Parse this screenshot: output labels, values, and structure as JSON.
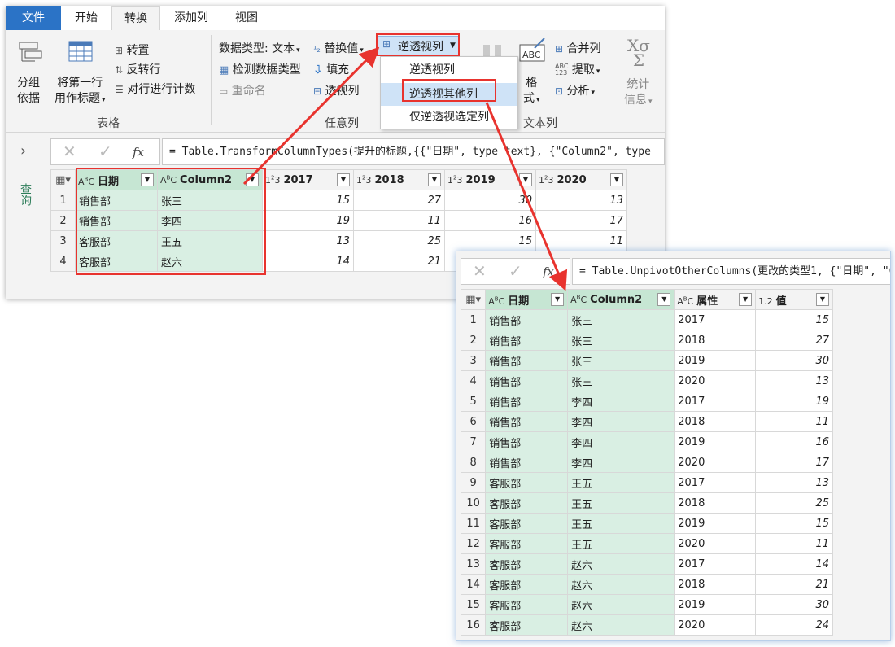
{
  "tabs": {
    "file": "文件",
    "home": "开始",
    "transform": "转换",
    "add_column": "添加列",
    "view": "视图"
  },
  "ribbon": {
    "table_group": {
      "group_by_line1": "分组",
      "group_by_line2": "依据",
      "use_first_row_line1": "将第一行",
      "use_first_row_line2": "用作标题",
      "transpose": "转置",
      "reverse_rows": "反转行",
      "count_rows": "对行进行计数",
      "label": "表格"
    },
    "any_column_group": {
      "data_type": "数据类型: 文本",
      "detect_type": "检测数据类型",
      "rename": "重命名",
      "replace_values": "替换值",
      "fill": "填充",
      "pivot": "透视列",
      "unpivot": "逆透视列",
      "label": "任意列"
    },
    "text_column_group": {
      "format_line1": "格",
      "format_line2": "式",
      "merge": "合并列",
      "extract": "提取",
      "parse": "分析",
      "label": "文本列"
    },
    "number_group": {
      "stats_line1": "统计",
      "stats_line2": "信息"
    }
  },
  "unpivot_menu": [
    "逆透视列",
    "逆透视其他列",
    "仅逆透视选定列"
  ],
  "queries_label": "查询",
  "fx_label": "fx",
  "formula1": "= Table.TransformColumnTypes(提升的标题,{{\"日期\", type text}, {\"Column2\", type",
  "table1": {
    "headers": [
      {
        "type": "ABC",
        "name": "日期"
      },
      {
        "type": "ABC",
        "name": "Column2"
      },
      {
        "type": "123",
        "name": "2017"
      },
      {
        "type": "123",
        "name": "2018"
      },
      {
        "type": "123",
        "name": "2019"
      },
      {
        "type": "123",
        "name": "2020"
      }
    ],
    "rows": [
      [
        "1",
        "销售部",
        "张三",
        "15",
        "27",
        "30",
        "13"
      ],
      [
        "2",
        "销售部",
        "李四",
        "19",
        "11",
        "16",
        "17"
      ],
      [
        "3",
        "客服部",
        "王五",
        "13",
        "25",
        "15",
        "11"
      ],
      [
        "4",
        "客服部",
        "赵六",
        "14",
        "21",
        "",
        ""
      ]
    ]
  },
  "formula2": "= Table.UnpivotOtherColumns(更改的类型1, {\"日期\", \"Column2\"}, \"属性\", \"值\")",
  "table2": {
    "headers": [
      {
        "type": "ABC",
        "name": "日期"
      },
      {
        "type": "ABC",
        "name": "Column2"
      },
      {
        "type": "ABC",
        "name": "属性"
      },
      {
        "type": "1.2",
        "name": "值"
      }
    ],
    "rows": [
      [
        "1",
        "销售部",
        "张三",
        "2017",
        "15"
      ],
      [
        "2",
        "销售部",
        "张三",
        "2018",
        "27"
      ],
      [
        "3",
        "销售部",
        "张三",
        "2019",
        "30"
      ],
      [
        "4",
        "销售部",
        "张三",
        "2020",
        "13"
      ],
      [
        "5",
        "销售部",
        "李四",
        "2017",
        "19"
      ],
      [
        "6",
        "销售部",
        "李四",
        "2018",
        "11"
      ],
      [
        "7",
        "销售部",
        "李四",
        "2019",
        "16"
      ],
      [
        "8",
        "销售部",
        "李四",
        "2020",
        "17"
      ],
      [
        "9",
        "客服部",
        "王五",
        "2017",
        "13"
      ],
      [
        "10",
        "客服部",
        "王五",
        "2018",
        "25"
      ],
      [
        "11",
        "客服部",
        "王五",
        "2019",
        "15"
      ],
      [
        "12",
        "客服部",
        "王五",
        "2020",
        "11"
      ],
      [
        "13",
        "客服部",
        "赵六",
        "2017",
        "14"
      ],
      [
        "14",
        "客服部",
        "赵六",
        "2018",
        "21"
      ],
      [
        "15",
        "客服部",
        "赵六",
        "2019",
        "30"
      ],
      [
        "16",
        "客服部",
        "赵六",
        "2020",
        "24"
      ]
    ]
  },
  "colors": {
    "file_tab": "#2b73c6",
    "selected_column": "#d9efe3",
    "highlight": "#e8332e",
    "menu_hover": "#cfe3f7"
  }
}
